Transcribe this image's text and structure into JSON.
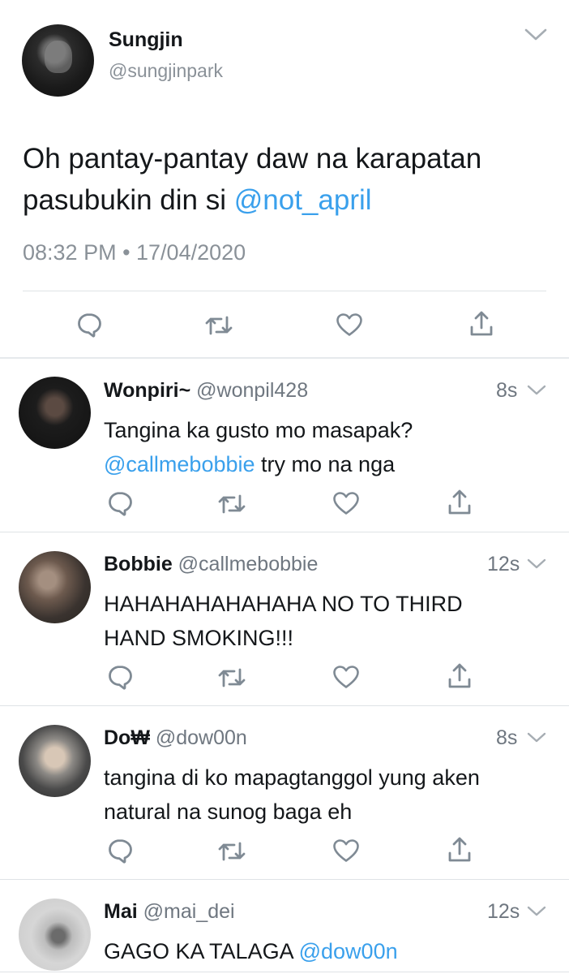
{
  "main_tweet": {
    "name": "Sungjin",
    "handle": "@sungjinpark",
    "text_prefix": "Oh pantay-pantay daw na karapatan pasubukin din si ",
    "mention": "@not_april",
    "timestamp": "08:32 PM • 17/04/2020"
  },
  "icons": {
    "reply": "reply-icon",
    "retweet": "retweet-icon",
    "like": "heart-icon",
    "share": "share-icon",
    "menu": "chevron-down-icon"
  },
  "colors": {
    "mention": "#3aa0ec",
    "secondary_text": "#6f7780",
    "divider": "#dfe3e6"
  },
  "replies": [
    {
      "name": "Wonpiri~",
      "handle": "@wonpil428",
      "time": "8s",
      "text_line1": "Tangina ka gusto mo masapak?",
      "mention": "@callmebobbie",
      "text_after_mention": " try mo na nga"
    },
    {
      "name": "Bobbie",
      "handle": "@callmebobbie",
      "time": "12s",
      "text_line1": "HAHAHAHAHAHAHA NO TO THIRD",
      "text_line2": "HAND SMOKING!!!"
    },
    {
      "name": "Do₩",
      "handle": "@dow00n",
      "time": "8s",
      "text_line1": "tangina di ko mapagtanggol yung aken",
      "text_line2": "natural na sunog baga eh"
    },
    {
      "name": "Mai",
      "handle": "@mai_dei",
      "time": "12s",
      "text_prefix": "GAGO KA TALAGA ",
      "mention": "@dow00n"
    }
  ]
}
